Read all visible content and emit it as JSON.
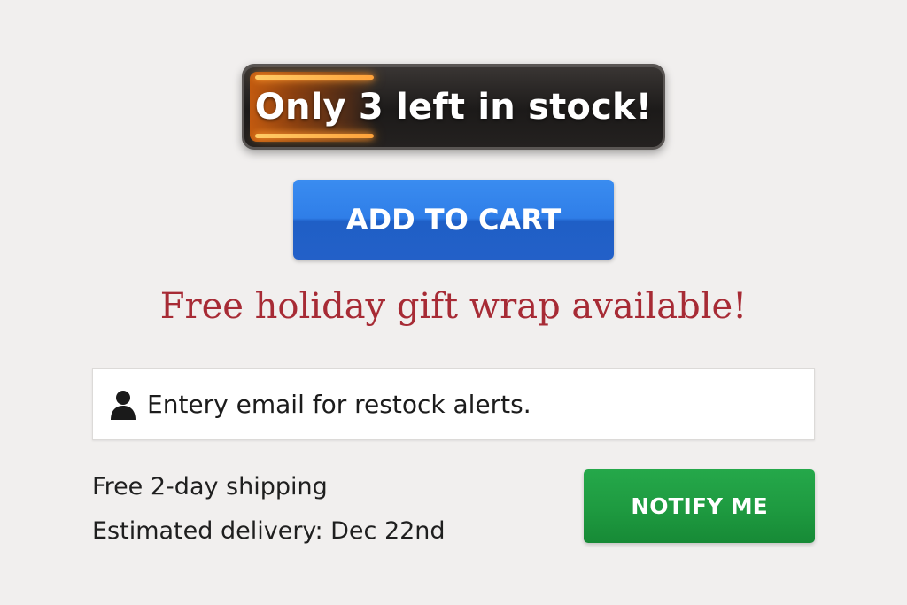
{
  "stock_badge": {
    "text": "Only 3 left in stock!",
    "fill_fraction": 0.3
  },
  "cart": {
    "add_label": "ADD TO CART"
  },
  "promo": {
    "text": "Free holiday gift wrap available!"
  },
  "restock": {
    "placeholder": "Entery email for restock alerts.",
    "icon": "user-icon"
  },
  "shipping": {
    "line1": "Free 2-day shipping",
    "line2": "Estimated delivery: Dec 22nd"
  },
  "notify": {
    "label": "NOTIFY ME"
  },
  "colors": {
    "background": "#f1efee",
    "cart_button": "#2f7ee8",
    "promo_text": "#a72b35",
    "notify_button": "#1e9a40",
    "stock_glow": "#ffa23a"
  }
}
